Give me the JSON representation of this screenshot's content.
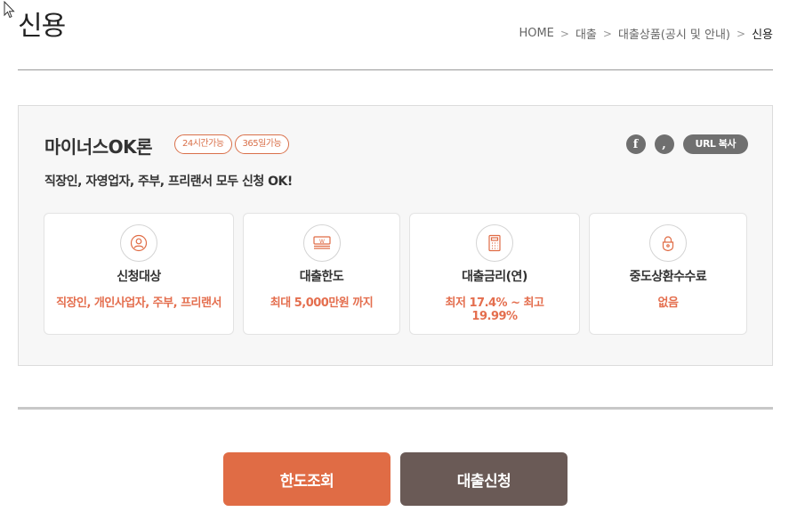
{
  "page": {
    "title": "신용"
  },
  "breadcrumb": [
    "HOME",
    "대출",
    "대출상품(공시 및 안내)",
    "신용"
  ],
  "breadcrumb_separator": ">",
  "product": {
    "name": "마이너스OK론",
    "tags": [
      "24시간가능",
      "365일가능"
    ],
    "description": "직장인, 자영업자, 주부, 프리랜서 모두 신청 OK!",
    "share": {
      "facebook_icon": "facebook-icon",
      "kakao_icon": "kakao-icon",
      "url_copy_label": "URL 복사"
    },
    "features": [
      {
        "icon": "person-icon",
        "label": "신청대상",
        "value": "직장인, 개인사업자, 주부, 프리랜서"
      },
      {
        "icon": "money-stack-icon",
        "label": "대출한도",
        "value": "최대 5,000만원 까지"
      },
      {
        "icon": "calculator-icon",
        "label": "대출금리(연)",
        "value": "최저 17.4% ~ 최고 19.99%"
      },
      {
        "icon": "lock-icon",
        "label": "중도상환수수료",
        "value": "없음"
      }
    ]
  },
  "buttons": {
    "limit_check": "한도조회",
    "loan_apply": "대출신청"
  },
  "colors": {
    "accent": "#e06c45",
    "accent_text": "#e46e4e",
    "secondary_button": "#6a5a56",
    "icon_gray": "#707070"
  }
}
